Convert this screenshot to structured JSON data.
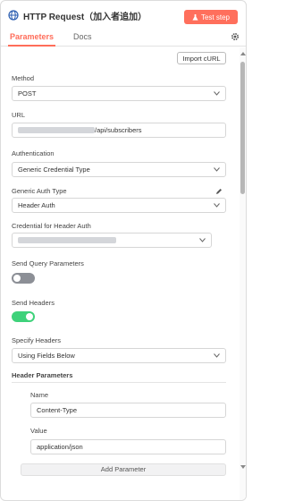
{
  "header": {
    "title": "HTTP Request（加入者追加）",
    "test_button": "Test step",
    "test_icon": "flask-icon",
    "node_icon": "globe-icon"
  },
  "tabs": [
    {
      "label": "Parameters",
      "active": true
    },
    {
      "label": "Docs",
      "active": false
    }
  ],
  "import_curl": "Import cURL",
  "fields": {
    "method": {
      "label": "Method",
      "value": "POST"
    },
    "url": {
      "label": "URL",
      "value_suffix": "/api/subscribers"
    },
    "authentication": {
      "label": "Authentication",
      "value": "Generic Credential Type"
    },
    "generic_auth_type": {
      "label": "Generic Auth Type",
      "value": "Header Auth"
    },
    "credential": {
      "label": "Credential for Header Auth"
    },
    "send_query": {
      "label": "Send Query Parameters",
      "on": false
    },
    "send_headers": {
      "label": "Send Headers",
      "on": true
    },
    "specify_headers": {
      "label": "Specify Headers",
      "value": "Using Fields Below"
    }
  },
  "header_parameters": {
    "section_label": "Header Parameters",
    "name_label": "Name",
    "name_value": "Content-Type",
    "value_label": "Value",
    "value_value": "application/json",
    "add_button": "Add Parameter"
  },
  "colors": {
    "accent": "#ff6d5a",
    "toggle_on": "#3ed27a",
    "toggle_off": "#8c8f96"
  }
}
